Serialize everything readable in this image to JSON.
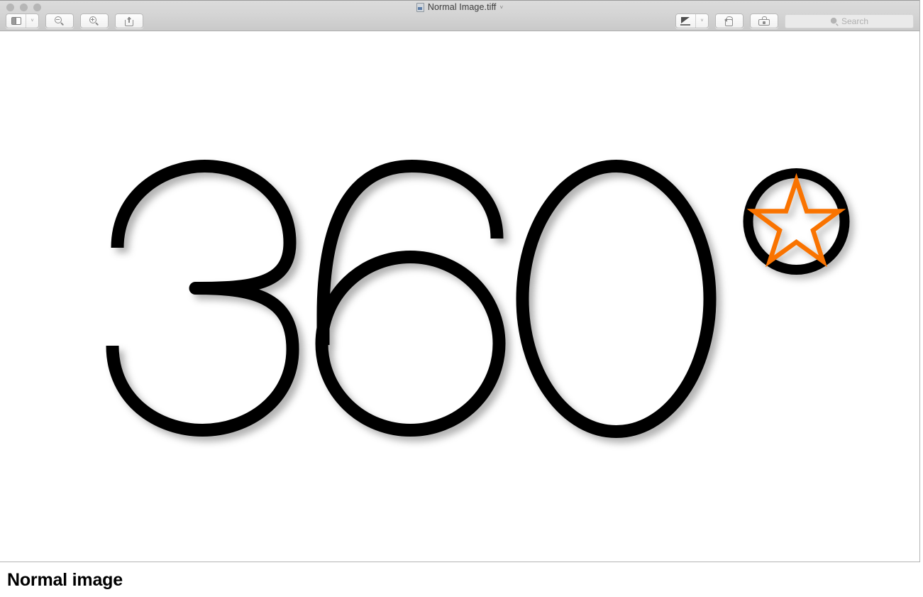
{
  "window": {
    "title": "Normal Image.tiff",
    "title_icon": "tiff-document-icon",
    "title_chevron": "˅",
    "traffic_lights": [
      {
        "name": "close-button",
        "color": "#b6b6b6"
      },
      {
        "name": "minimize-button",
        "color": "#b6b6b6"
      },
      {
        "name": "zoom-button",
        "color": "#b6b6b6"
      }
    ]
  },
  "toolbar": {
    "left": [
      {
        "name": "sidebar-toggle-button",
        "icon": "sidebar-icon",
        "has_dropdown": true,
        "dropdown_glyph": "˅"
      },
      {
        "name": "zoom-out-button",
        "icon": "magnifier-minus-icon"
      },
      {
        "name": "zoom-in-button",
        "icon": "magnifier-plus-icon"
      },
      {
        "name": "share-button",
        "icon": "share-icon"
      }
    ],
    "right": [
      {
        "name": "markup-pen-button",
        "icon": "pen-icon",
        "has_dropdown": true,
        "dropdown_glyph": "˅"
      },
      {
        "name": "rotate-button",
        "icon": "rotate-counterclockwise-icon"
      },
      {
        "name": "markup-toolbar-button",
        "icon": "toolbox-icon"
      }
    ],
    "search": {
      "name": "search-input",
      "placeholder": "Search",
      "value": "",
      "icon": "search-icon"
    }
  },
  "artwork": {
    "name": "360-degree-star-graphic",
    "text": "360",
    "digits": [
      "3",
      "6",
      "0"
    ],
    "degree_symbol": {
      "type": "circle-with-star",
      "ring_color": "#000000",
      "star_color": "#f97306",
      "star_points": 5
    },
    "stroke_color": "#000000",
    "background": "#ffffff",
    "shadow": "drop-shadow"
  },
  "caption": {
    "text": "Normal image"
  },
  "colors": {
    "accent_orange": "#f97306",
    "stroke_black": "#000000",
    "toolbar_top": "#dcdcdc",
    "toolbar_bottom": "#c9c9c9",
    "window_border": "#b4b4b4",
    "canvas": "#ffffff"
  }
}
